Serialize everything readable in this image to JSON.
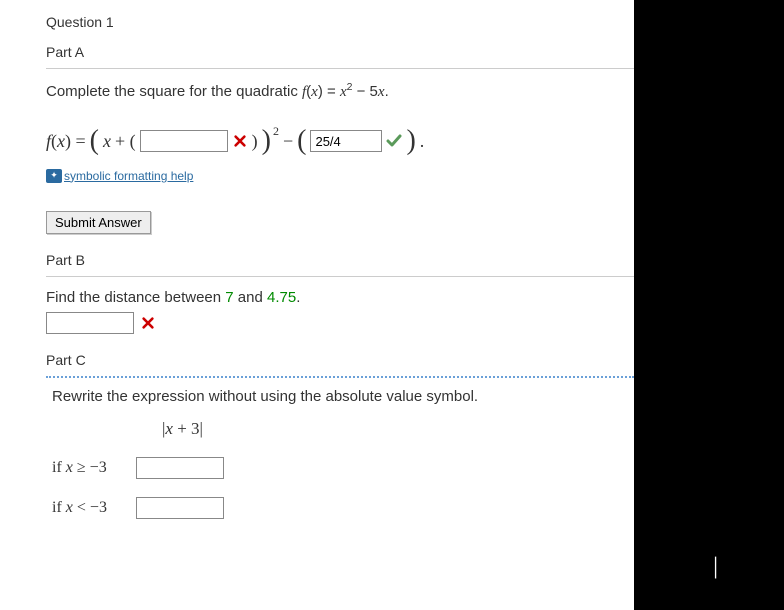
{
  "question_title": "Question 1",
  "partA": {
    "label": "Part A",
    "prompt_prefix": "Complete the square for the quadratic ",
    "prompt_fx": "f",
    "prompt_x": "x",
    "prompt_eq": " = ",
    "prompt_rhs": "x",
    "prompt_exp": "2",
    "prompt_tail": " − 5",
    "prompt_tail_x": "x",
    "prompt_period": ".",
    "eq_fx": "f",
    "eq_x": "x",
    "eq_open": "(",
    "eq_plus": " + (",
    "blank1_value": "",
    "eq_close1": ")",
    "eq_close_big": ")",
    "eq_minus": " − ",
    "eq_open2": "(",
    "blank2_value": "25/4",
    "eq_close2": ")",
    "eq_period": ".",
    "help_text": "symbolic formatting help",
    "submit_label": "Submit Answer"
  },
  "partB": {
    "label": "Part B",
    "prompt_pre": "Find the distance between ",
    "val1": "7",
    "prompt_mid": " and ",
    "val2": "4.75",
    "prompt_post": ".",
    "blank_value": ""
  },
  "partC": {
    "label": "Part C",
    "prompt": "Rewrite the expression without using the absolute value symbol.",
    "abs_open": "|",
    "abs_var": "x",
    "abs_plus": " + 3",
    "abs_close": "|",
    "case1_pre": "if ",
    "case1_var": "x",
    "case1_rel": " ≥ −3",
    "case1_value": "",
    "case2_pre": "if ",
    "case2_var": "x",
    "case2_rel": " < −3",
    "case2_value": ""
  }
}
